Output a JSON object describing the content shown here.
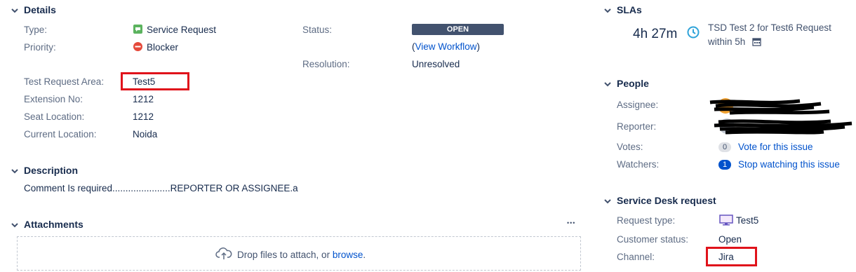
{
  "details": {
    "heading": "Details",
    "fields": {
      "type_label": "Type:",
      "type_value": "Service Request",
      "priority_label": "Priority:",
      "priority_value": "Blocker",
      "test_request_area_label": "Test Request Area:",
      "test_request_area_value": "Test5",
      "extension_label": "Extension No:",
      "extension_value": "1212",
      "seat_label": "Seat Location:",
      "seat_value": "1212",
      "current_location_label": "Current Location:",
      "current_location_value": "Noida",
      "status_label": "Status:",
      "status_value": "OPEN",
      "view_workflow_open": "(",
      "view_workflow_link": "View Workflow",
      "view_workflow_close": ")",
      "resolution_label": "Resolution:",
      "resolution_value": "Unresolved"
    }
  },
  "description": {
    "heading": "Description",
    "text": "Comment Is required......................REPORTER OR ASSIGNEE.a"
  },
  "attachments": {
    "heading": "Attachments",
    "more": "•••",
    "drop_text": "Drop files to attach, or ",
    "browse_link": "browse",
    "drop_tail": "."
  },
  "slas": {
    "heading": "SLAs",
    "time": "4h 27m",
    "title": "TSD Test 2 for Test6 Request",
    "within": "within 5h"
  },
  "people": {
    "heading": "People",
    "assignee_label": "Assignee:",
    "reporter_label": "Reporter:",
    "votes_label": "Votes:",
    "votes_count": "0",
    "votes_link": "Vote for this issue",
    "watchers_label": "Watchers:",
    "watchers_count": "1",
    "watchers_link": "Stop watching this issue"
  },
  "service_desk": {
    "heading": "Service Desk request",
    "request_type_label": "Request type:",
    "request_type_value": "Test5",
    "customer_status_label": "Customer status:",
    "customer_status_value": "Open",
    "channel_label": "Channel:",
    "channel_value": "Jira"
  },
  "colors": {
    "link": "#0052cc",
    "status_lozenge": "#42526e",
    "highlight_box": "#e0131b",
    "service_request_icon": "#5bb35e",
    "blocker_icon": "#e5493a",
    "sla_clock": "#2fa3d9"
  }
}
